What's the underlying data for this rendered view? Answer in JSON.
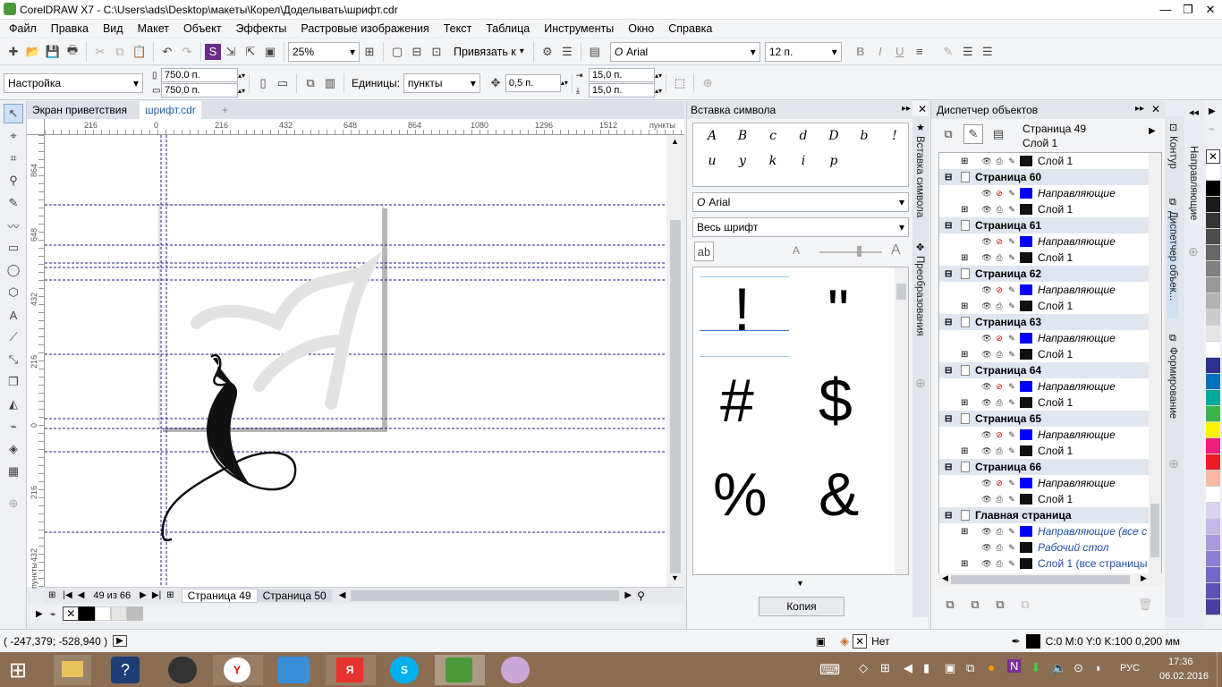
{
  "window": {
    "title": "CorelDRAW X7 - C:\\Users\\ads\\Desktop\\макеты\\Корел\\Доделывать\\шрифт.cdr",
    "minimize": "—",
    "restore": "❐",
    "close": "✕"
  },
  "menu": [
    "Файл",
    "Правка",
    "Вид",
    "Макет",
    "Объект",
    "Эффекты",
    "Растровые изображения",
    "Текст",
    "Таблица",
    "Инструменты",
    "Окно",
    "Справка"
  ],
  "toolbar1": {
    "zoom": "25%",
    "snap_label": "Привязать к",
    "font": "Arial",
    "font_size": "12 п."
  },
  "toolbar2": {
    "preset": "Настройка",
    "width": "750,0 п.",
    "height": "750,0 п.",
    "units_label": "Единицы:",
    "units": "пункты",
    "nudge": "0,5 п.",
    "dup_x": "15,0 п.",
    "dup_y": "15,0 п."
  },
  "doctabs": {
    "welcome": "Экран приветствия",
    "file": "шрифт.cdr",
    "add": "+"
  },
  "rulers": {
    "h_labels": [
      "216",
      "0",
      "216",
      "432",
      "648",
      "864",
      "1080",
      "1296",
      "1512"
    ],
    "h_unit": "пункты",
    "v_labels": [
      "864",
      "648",
      "432",
      "216",
      "0",
      "216",
      "432"
    ],
    "v_unit": "пункты"
  },
  "pagenav": {
    "counter": "49 из 66",
    "tabs": [
      "Страница 49",
      "Страница 50"
    ]
  },
  "symbol_panel": {
    "title": "Вставка символа",
    "font": "Arial",
    "subset": "Весь шрифт",
    "recent": [
      "A",
      "B",
      "c",
      "d",
      "D",
      "b",
      "!",
      "u",
      "y",
      "k",
      "i",
      "p"
    ],
    "glyphs": [
      "!",
      "\"",
      "#",
      "$",
      "%",
      "&"
    ],
    "copy_button": "Копия"
  },
  "side_tabs_1": [
    "Вставка символа",
    "Преобразования"
  ],
  "object_panel": {
    "title": "Диспетчер объектов",
    "current_page": "Страница 49",
    "current_layer": "Слой 1",
    "rows": [
      {
        "type": "layer",
        "label": "Слой 1",
        "expand": "+"
      },
      {
        "type": "page",
        "label": "Страница 60"
      },
      {
        "type": "guide",
        "label": "Направляющие"
      },
      {
        "type": "layer",
        "label": "Слой 1",
        "expand": "+"
      },
      {
        "type": "page",
        "label": "Страница 61"
      },
      {
        "type": "guide",
        "label": "Направляющие"
      },
      {
        "type": "layer",
        "label": "Слой 1",
        "expand": "+"
      },
      {
        "type": "page",
        "label": "Страница 62"
      },
      {
        "type": "guide",
        "label": "Направляющие"
      },
      {
        "type": "layer",
        "label": "Слой 1",
        "expand": "+"
      },
      {
        "type": "page",
        "label": "Страница 63"
      },
      {
        "type": "guide",
        "label": "Направляющие"
      },
      {
        "type": "layer",
        "label": "Слой 1",
        "expand": "+"
      },
      {
        "type": "page",
        "label": "Страница 64"
      },
      {
        "type": "guide",
        "label": "Направляющие"
      },
      {
        "type": "layer",
        "label": "Слой 1",
        "expand": "+"
      },
      {
        "type": "page",
        "label": "Страница 65"
      },
      {
        "type": "guide",
        "label": "Направляющие"
      },
      {
        "type": "layer",
        "label": "Слой 1",
        "expand": "+"
      },
      {
        "type": "page",
        "label": "Страница 66"
      },
      {
        "type": "guide",
        "label": "Направляющие"
      },
      {
        "type": "layer",
        "label": "Слой 1",
        "expand": ""
      },
      {
        "type": "page",
        "label": "Главная страница"
      },
      {
        "type": "master",
        "label": "Направляющие (все с",
        "expand": "+"
      },
      {
        "type": "master",
        "label": "Рабочий стол",
        "expand": ""
      },
      {
        "type": "master",
        "label": "Слой 1 (все страницы",
        "expand": "+"
      }
    ]
  },
  "side_tabs_2": [
    "Контур",
    "Диспетчер объек...",
    "Формирование"
  ],
  "side_tab_far": "Направляющие",
  "status": {
    "coords": "( -247,379; -528,940 )",
    "fill_none": "Нет",
    "outline": "C:0 M:0 Y:0 K:100  0,200 мм"
  },
  "taskbar": {
    "lang": "РУС",
    "time": "17:36",
    "date": "06.02.2016"
  },
  "palette_colors": [
    "#ffffff",
    "#000000",
    "#1a1a1a",
    "#333333",
    "#4d4d4d",
    "#666666",
    "#808080",
    "#999999",
    "#b3b3b3",
    "#cccccc",
    "#e6e6e6",
    "#ffffff",
    "#2e3192",
    "#0071bc",
    "#00a99d",
    "#39b54a",
    "#fff200",
    "#ed1e79",
    "#ed1c24",
    "#f7b8a4",
    "#ffffff",
    "#d9d3f0",
    "#c3b8e8",
    "#a99ae0",
    "#8d7fd8",
    "#7568c8",
    "#5e52b8",
    "#4a3f9e"
  ]
}
